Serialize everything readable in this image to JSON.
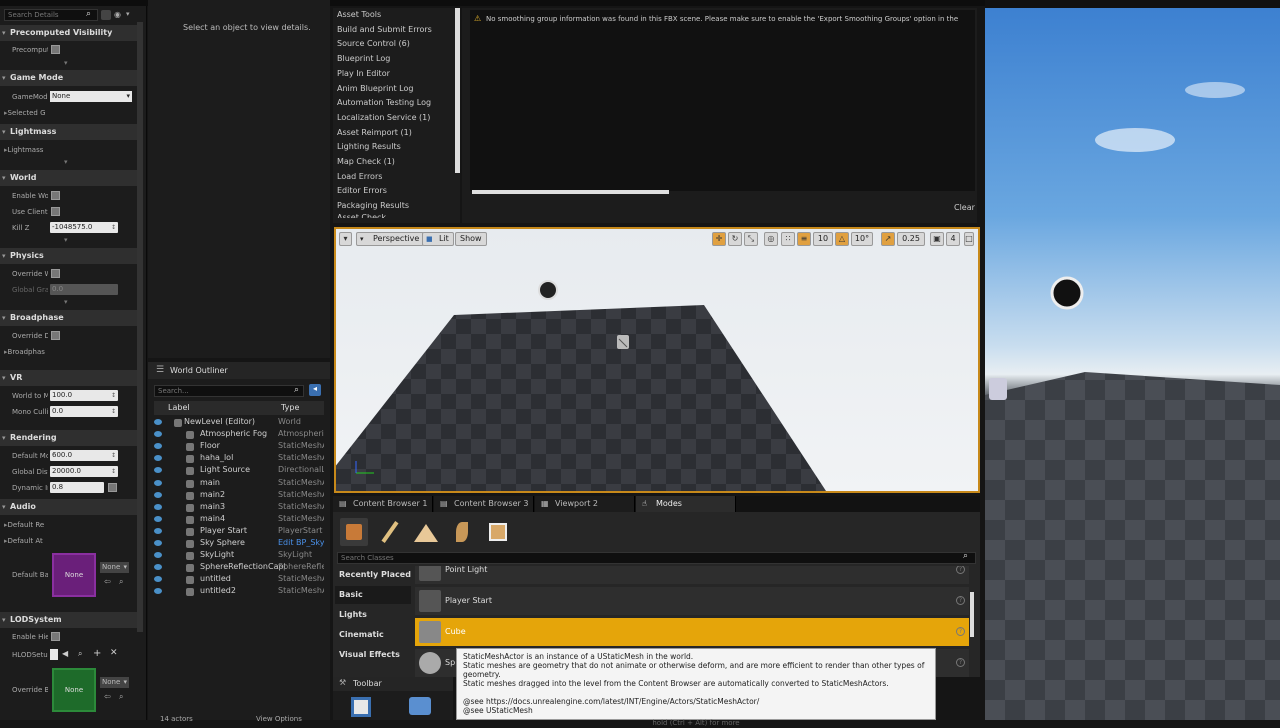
{
  "details": {
    "search_placeholder": "Search Details",
    "categories": [
      {
        "title": "Precomputed Visibility"
      },
      {
        "title": "Game Mode"
      },
      {
        "title": "Lightmass"
      },
      {
        "title": "World"
      },
      {
        "title": "Physics"
      },
      {
        "title": "Broadphase"
      },
      {
        "title": "VR"
      },
      {
        "title": "Rendering"
      },
      {
        "title": "Audio"
      },
      {
        "title": "LODSystem"
      }
    ],
    "props": {
      "precomputed": "Precomput",
      "gamemode": "GameMod",
      "gamemode_value": "None",
      "selected": "Selected G",
      "lightmass": "Lightmass",
      "enable_world": "Enable Wo",
      "use_client": "Use Client",
      "kill_z": "Kill Z",
      "kill_z_value": "-1048575.0",
      "override_w": "Override W",
      "global_gra": "Global Gra",
      "global_gra_value": "0.0",
      "override_d": "Override D",
      "broadphas": "Broadphas",
      "world_to_m": "World to M",
      "world_to_m_value": "100.0",
      "mono_cull": "Mono Culli",
      "mono_cull_value": "0.0",
      "default_mo": "Default Mo",
      "default_mo_value": "600.0",
      "global_dist": "Global Dist",
      "global_dist_value": "20000.0",
      "dynamic": "Dynamic In",
      "dynamic_value": "0.8",
      "default_re": "Default Re",
      "default_at": "Default At",
      "default_ba": "Default Ba",
      "none_thumb": "None",
      "none_select": "None",
      "enable_hie": "Enable Hie",
      "hlod_setup": "HLODSetu",
      "override_b": "Override B"
    }
  },
  "levels": {
    "hint": "Select an object to view details."
  },
  "outliner": {
    "title": "World Outliner",
    "search_placeholder": "Search...",
    "col_label": "Label",
    "col_type": "Type",
    "rows": [
      {
        "label": "NewLevel (Editor)",
        "type": "World"
      },
      {
        "label": "Atmospheric Fog",
        "type": "Atmospheric"
      },
      {
        "label": "Floor",
        "type": "StaticMeshA"
      },
      {
        "label": "haha_lol",
        "type": "StaticMeshA"
      },
      {
        "label": "Light Source",
        "type": "DirectionalLi"
      },
      {
        "label": "main",
        "type": "StaticMeshA"
      },
      {
        "label": "main2",
        "type": "StaticMeshA"
      },
      {
        "label": "main3",
        "type": "StaticMeshA"
      },
      {
        "label": "main4",
        "type": "StaticMeshA"
      },
      {
        "label": "Player Start",
        "type": "PlayerStart"
      },
      {
        "label": "Sky Sphere",
        "type": "Edit BP_Sky"
      },
      {
        "label": "SkyLight",
        "type": "SkyLight"
      },
      {
        "label": "SphereReflectionCapt",
        "type": "SphereReflec"
      },
      {
        "label": "untitled",
        "type": "StaticMeshA"
      },
      {
        "label": "untitled2",
        "type": "StaticMeshA"
      }
    ],
    "footer_count": "14 actors",
    "view_options": "View Options"
  },
  "message_log": {
    "items": [
      "Asset Tools",
      "Build and Submit Errors",
      "Source Control (6)",
      "Blueprint Log",
      "Play In Editor",
      "Anim Blueprint Log",
      "Automation Testing Log",
      "Localization Service (1)",
      "Asset Reimport (1)",
      "Lighting Results",
      "Map Check (1)",
      "Load Errors",
      "Editor Errors",
      "Packaging Results",
      "Asset Check"
    ],
    "message": "No smoothing group information was found in this FBX scene.  Please make sure to enable the 'Export Smoothing Groups' option in the",
    "clear": "Clear"
  },
  "viewport": {
    "perspective": "Perspective",
    "lit": "Lit",
    "show": "Show",
    "grid_snap": "10",
    "rot_snap": "10°",
    "scale_snap": "0.25",
    "cam_speed": "4"
  },
  "bottom_tabs": [
    "Content Browser 1",
    "Content Browser 3",
    "Viewport 2",
    "Modes"
  ],
  "modes": {
    "search_placeholder": "Search Classes",
    "categories": [
      "Recently Placed",
      "Basic",
      "Lights",
      "Cinematic",
      "Visual Effects"
    ],
    "items": [
      "Point Light",
      "Player Start",
      "Cube",
      "Sp"
    ],
    "tooltip": {
      "line1": "StaticMeshActor is an instance of a UStaticMesh in the world.",
      "line2": "Static meshes are geometry that do not animate or otherwise deform, and are more efficient to render than other types of geometry.",
      "line3": "Static meshes dragged into the level from the Content Browser are automatically converted to StaticMeshActors.",
      "line4": "@see https://docs.unrealengine.com/latest/INT/Engine/Actors/StaticMeshActor/",
      "line5": "@see UStaticMesh",
      "hint": "hold (Ctrl + Alt) for more"
    }
  },
  "toolbar": {
    "title": "Toolbar"
  },
  "colors": {
    "accent": "#e5a50a",
    "viewport_border": "#c7891a"
  }
}
